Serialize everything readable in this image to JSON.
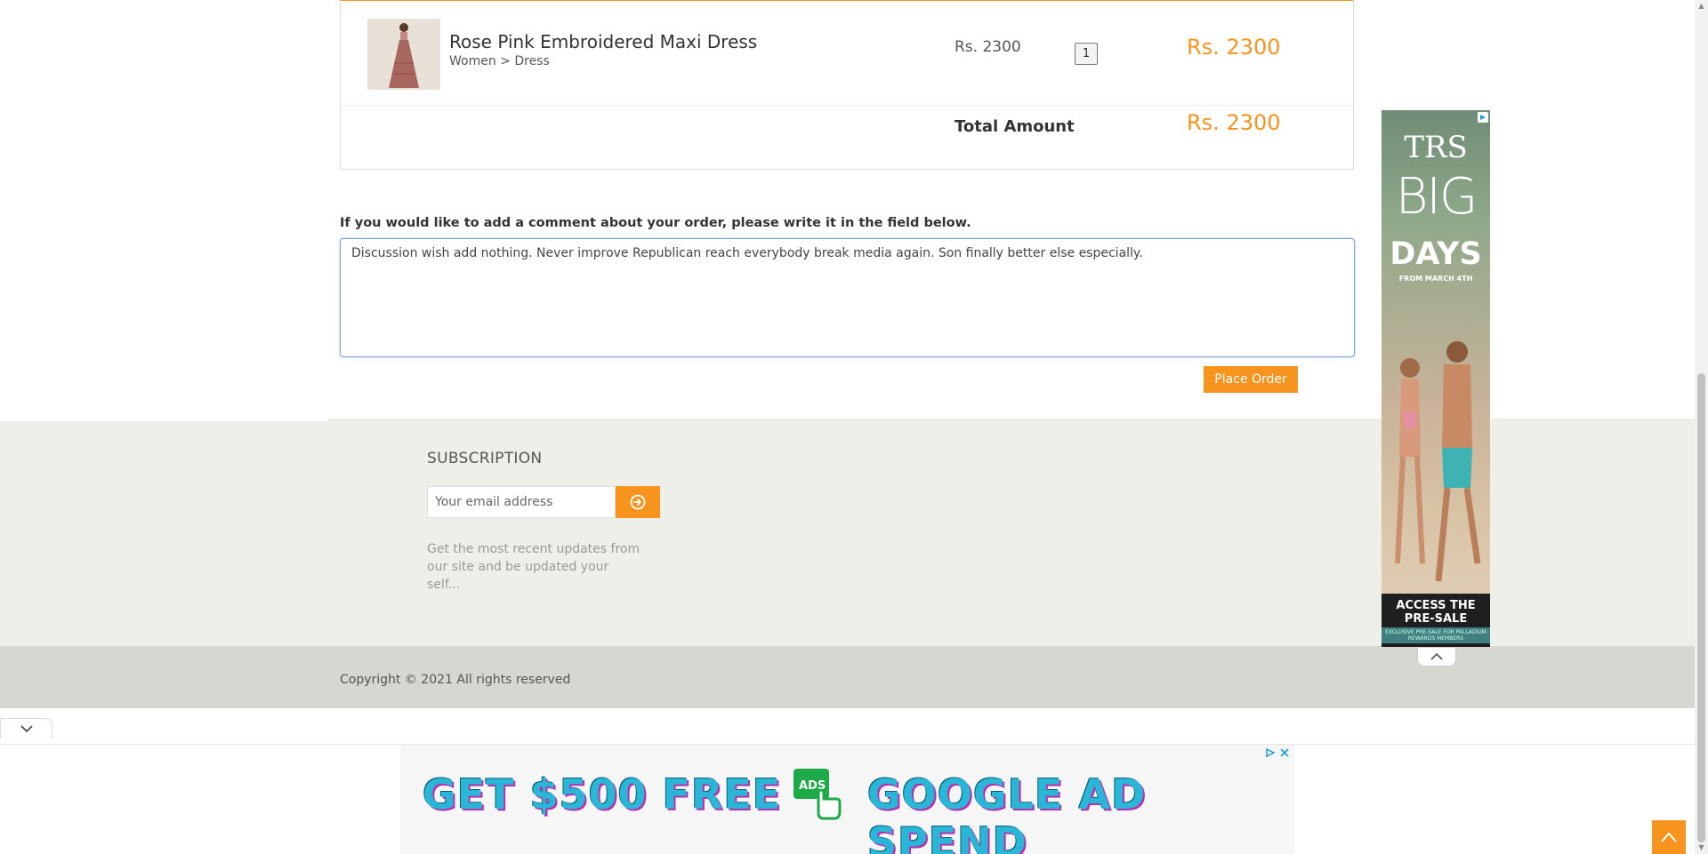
{
  "cart": {
    "item": {
      "name": "Rose Pink Embroidered Maxi Dress",
      "category": "Women > Dress",
      "unit_price": "Rs. 2300",
      "quantity": "1",
      "row_total": "Rs. 2300"
    },
    "total_label": "Total Amount",
    "total_value": "Rs. 2300"
  },
  "comment": {
    "label": "If you would like to add a comment about your order, please write it in the field below.",
    "value": "Discussion wish add nothing. Never improve Republican reach everybody break media again. Son finally better else especially."
  },
  "place_order_label": "Place Order",
  "footer": {
    "subscription_title": "SUBSCRIPTION",
    "email_placeholder": "Your email address",
    "description": "Get the most recent updates from our site and be updated your self...",
    "copyright": "Copyright © 2021 All rights reserved"
  },
  "side_ad": {
    "logo": "TRS",
    "headline_1": "BIG",
    "headline_2": "DAYS",
    "date_line": "FROM MARCH 4TH",
    "cta": "ACCESS THE PRE-SALE",
    "cta_sub": "EXCLUSIVE PRE-SALE FOR PALLADIUM REWARDS MEMBERS"
  },
  "bottom_ad": {
    "text_left": "GET $500 FREE",
    "badge": "ADS",
    "text_right": "GOOGLE AD SPEND"
  },
  "colors": {
    "accent": "#f7941d",
    "footer_bg": "#efefe9",
    "footer_bottom_bg": "#d7d7d2"
  }
}
